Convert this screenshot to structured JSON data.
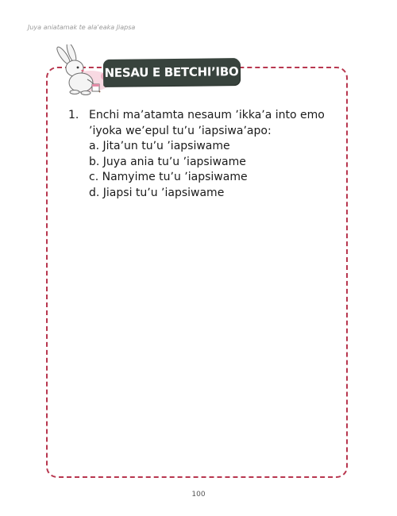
{
  "header": {
    "running_title": "Juya aniatamak te alaʼeaka Jiapsa"
  },
  "section": {
    "title": "NESAU E BETCHIʼIBO",
    "mascot_icon": "rabbit-mascot-icon"
  },
  "question": {
    "number": "1.",
    "text": "Enchi maʼatamta nesaum ʼikkaʼa into emo ʼiyoka weʼepul tuʼu ʼiapsiwaʼapo:",
    "options": [
      "a. Jitaʼun tuʼu ʼiapsiwame",
      "b. Juya ania tuʼu ʼiapsiwame",
      "c. Namyime tuʼu ʼiapsiwame",
      "d. Jiapsi tuʼu ʼiapsiwame"
    ]
  },
  "footer": {
    "page_number": "100"
  },
  "colors": {
    "frame_border": "#b8374f",
    "banner_background": "#38433d",
    "banner_text": "#ffffff",
    "accent_pink": "#e58aa6"
  }
}
